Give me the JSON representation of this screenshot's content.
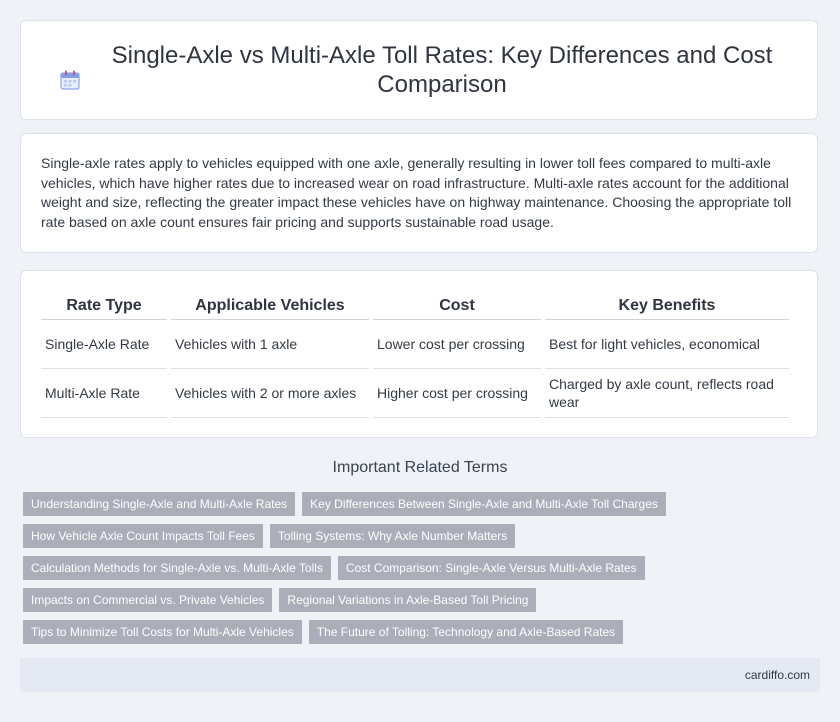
{
  "header": {
    "title": "Single-Axle vs Multi-Axle Toll Rates: Key Differences and Cost Comparison",
    "icon": "calendar-icon",
    "accent": "#6c8fe6"
  },
  "intro": {
    "text": "Single-axle rates apply to vehicles equipped with one axle, generally resulting in lower toll fees compared to multi-axle vehicles, which have higher rates due to increased wear on road infrastructure. Multi-axle rates account for the additional weight and size, reflecting the greater impact these vehicles have on highway maintenance. Choosing the appropriate toll rate based on axle count ensures fair pricing and supports sustainable road usage."
  },
  "table": {
    "headers": [
      "Rate Type",
      "Applicable Vehicles",
      "Cost",
      "Key Benefits"
    ],
    "rows": [
      [
        "Single-Axle Rate",
        "Vehicles with 1 axle",
        "Lower cost per crossing",
        "Best for light vehicles, economical"
      ],
      [
        "Multi-Axle Rate",
        "Vehicles with 2 or more axles",
        "Higher cost per crossing",
        "Charged by axle count, reflects road wear"
      ]
    ]
  },
  "related": {
    "heading": "Important Related Terms",
    "rows": [
      [
        "Understanding Single-Axle and Multi-Axle Rates",
        "Key Differences Between Single-Axle and Multi-Axle Toll Charges"
      ],
      [
        "How Vehicle Axle Count Impacts Toll Fees",
        "Tolling Systems: Why Axle Number Matters"
      ],
      [
        "Calculation Methods for Single-Axle vs. Multi-Axle Tolls",
        "Cost Comparison: Single-Axle Versus Multi-Axle Rates"
      ],
      [
        "Impacts on Commercial vs. Private Vehicles",
        "Regional Variations in Axle-Based Toll Pricing"
      ],
      [
        "Tips to Minimize Toll Costs for Multi-Axle Vehicles",
        "The Future of Tolling: Technology and Axle-Based Rates"
      ]
    ]
  },
  "footer": {
    "brand": "cardiffo.com"
  }
}
